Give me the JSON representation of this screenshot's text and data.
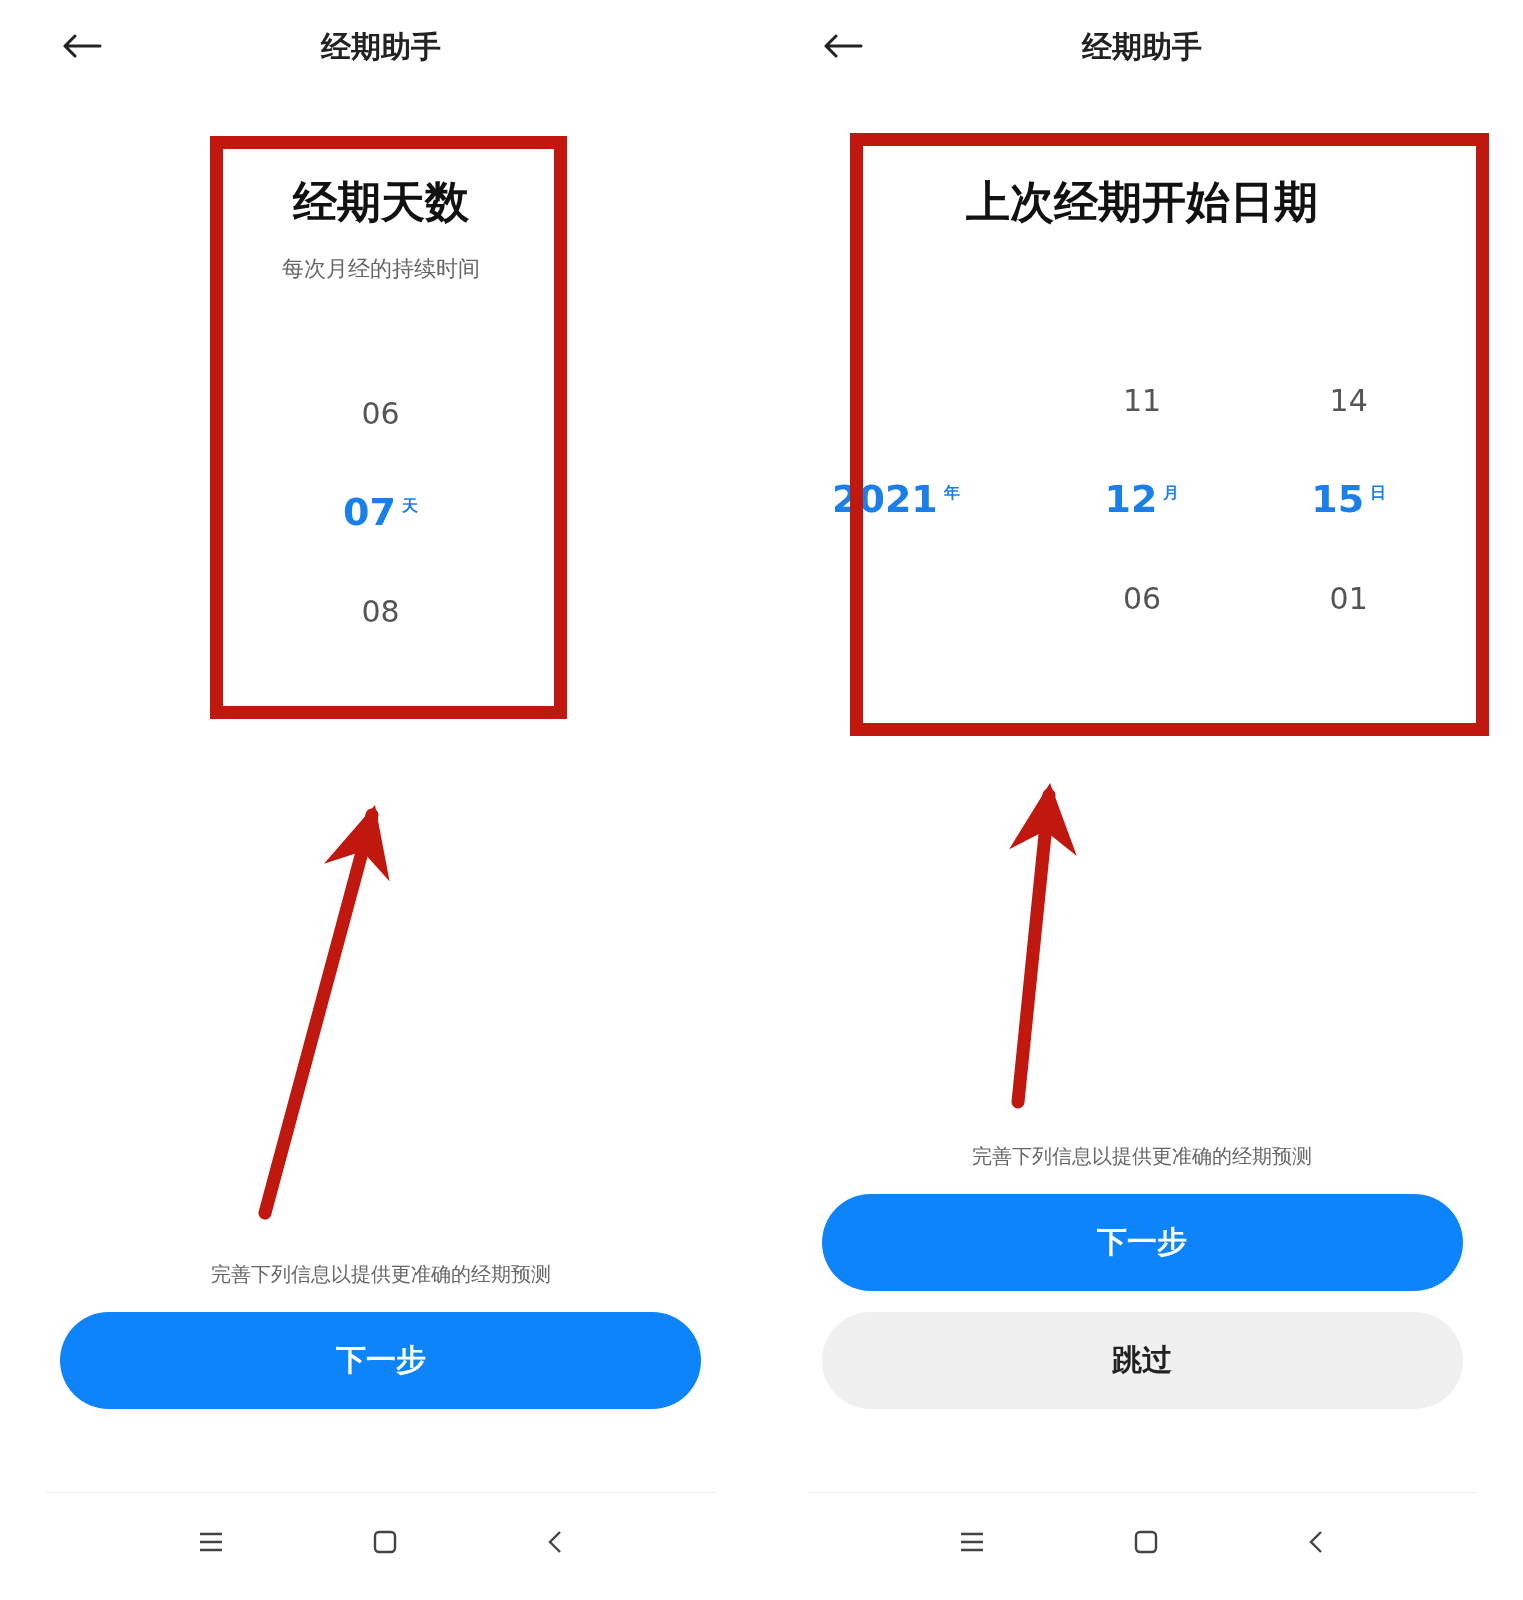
{
  "screens": [
    {
      "title": "经期助手",
      "heading": "经期天数",
      "subheading": "每次月经的持续时间",
      "columns": [
        {
          "items": [
            {
              "value": "06",
              "selected": false
            },
            {
              "value": "07",
              "unit": "天",
              "selected": true
            },
            {
              "value": "08",
              "selected": false
            }
          ]
        }
      ],
      "hint": "完善下列信息以提供更准确的经期预测",
      "buttons": [
        {
          "label": "下一步",
          "kind": "primary"
        }
      ]
    },
    {
      "title": "经期助手",
      "heading": "上次经期开始日期",
      "columns": [
        {
          "items": [
            {
              "value": "2021",
              "unit": "年",
              "selected": true
            }
          ]
        },
        {
          "items": [
            {
              "value": "11",
              "selected": false
            },
            {
              "value": "12",
              "unit": "月",
              "selected": true
            },
            {
              "value": "06",
              "selected": false
            }
          ]
        },
        {
          "items": [
            {
              "value": "14",
              "selected": false
            },
            {
              "value": "15",
              "unit": "日",
              "selected": true
            },
            {
              "value": "01",
              "selected": false
            }
          ]
        }
      ],
      "hint": "完善下列信息以提供更准确的经期预测",
      "buttons": [
        {
          "label": "下一步",
          "kind": "primary"
        },
        {
          "label": "跳过",
          "kind": "secondary"
        }
      ]
    }
  ]
}
